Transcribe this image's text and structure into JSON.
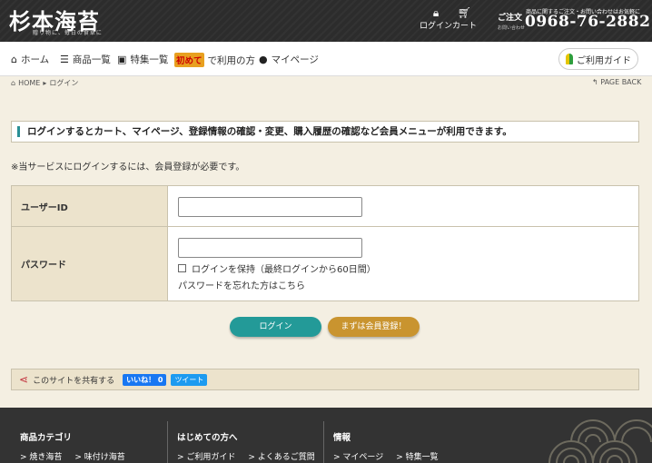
{
  "header": {
    "logo": "杉本海苔",
    "logo_sub": "贈り物に、毎日の食卓に",
    "login_label": "ログイン",
    "cart_label": "カート",
    "order_label": "ご注文",
    "order_sub": "お問い合わせ",
    "order_note": "商品に関するご注文・お問い合わせはお気軽に",
    "phone": "0968-76-2882"
  },
  "nav": {
    "home": "ホーム",
    "products": "商品一覧",
    "special": "特集一覧",
    "first_badge": "初めて",
    "first_suffix": "で利用の方",
    "mypage": "マイページ",
    "guide": "ご利用ガイド"
  },
  "breadcrumb": {
    "home": "HOME",
    "current": "ログイン",
    "page_back": "PAGE BACK"
  },
  "main": {
    "notice": "ログインするとカート、マイページ、登録情報の確認・変更、購入履歴の確認など会員メニューが利用できます。",
    "requirement": "※当サービスにログインするには、会員登録が必要です。",
    "user_id_label": "ユーザーID",
    "user_id_value": "",
    "password_label": "パスワード",
    "password_value": "",
    "keep_login": "ログインを保持（最終ログインから60日間）",
    "forgot": "パスワードを忘れた方はこちら",
    "login_button": "ログイン",
    "register_button": "まずは会員登録！"
  },
  "share": {
    "label": "このサイトを共有する",
    "facebook": "いいね！ 0",
    "twitter": "ツイート"
  },
  "footer": {
    "col1": {
      "head": "商品カテゴリ",
      "links": [
        "> 焼き海苔",
        "> 味付け海苔"
      ]
    },
    "col2": {
      "head": "はじめての方へ",
      "links": [
        "> ご利用ガイド",
        "> よくあるご質問"
      ]
    },
    "col3": {
      "head": "情報",
      "links": [
        "> マイページ",
        "> 特集一覧"
      ]
    }
  }
}
